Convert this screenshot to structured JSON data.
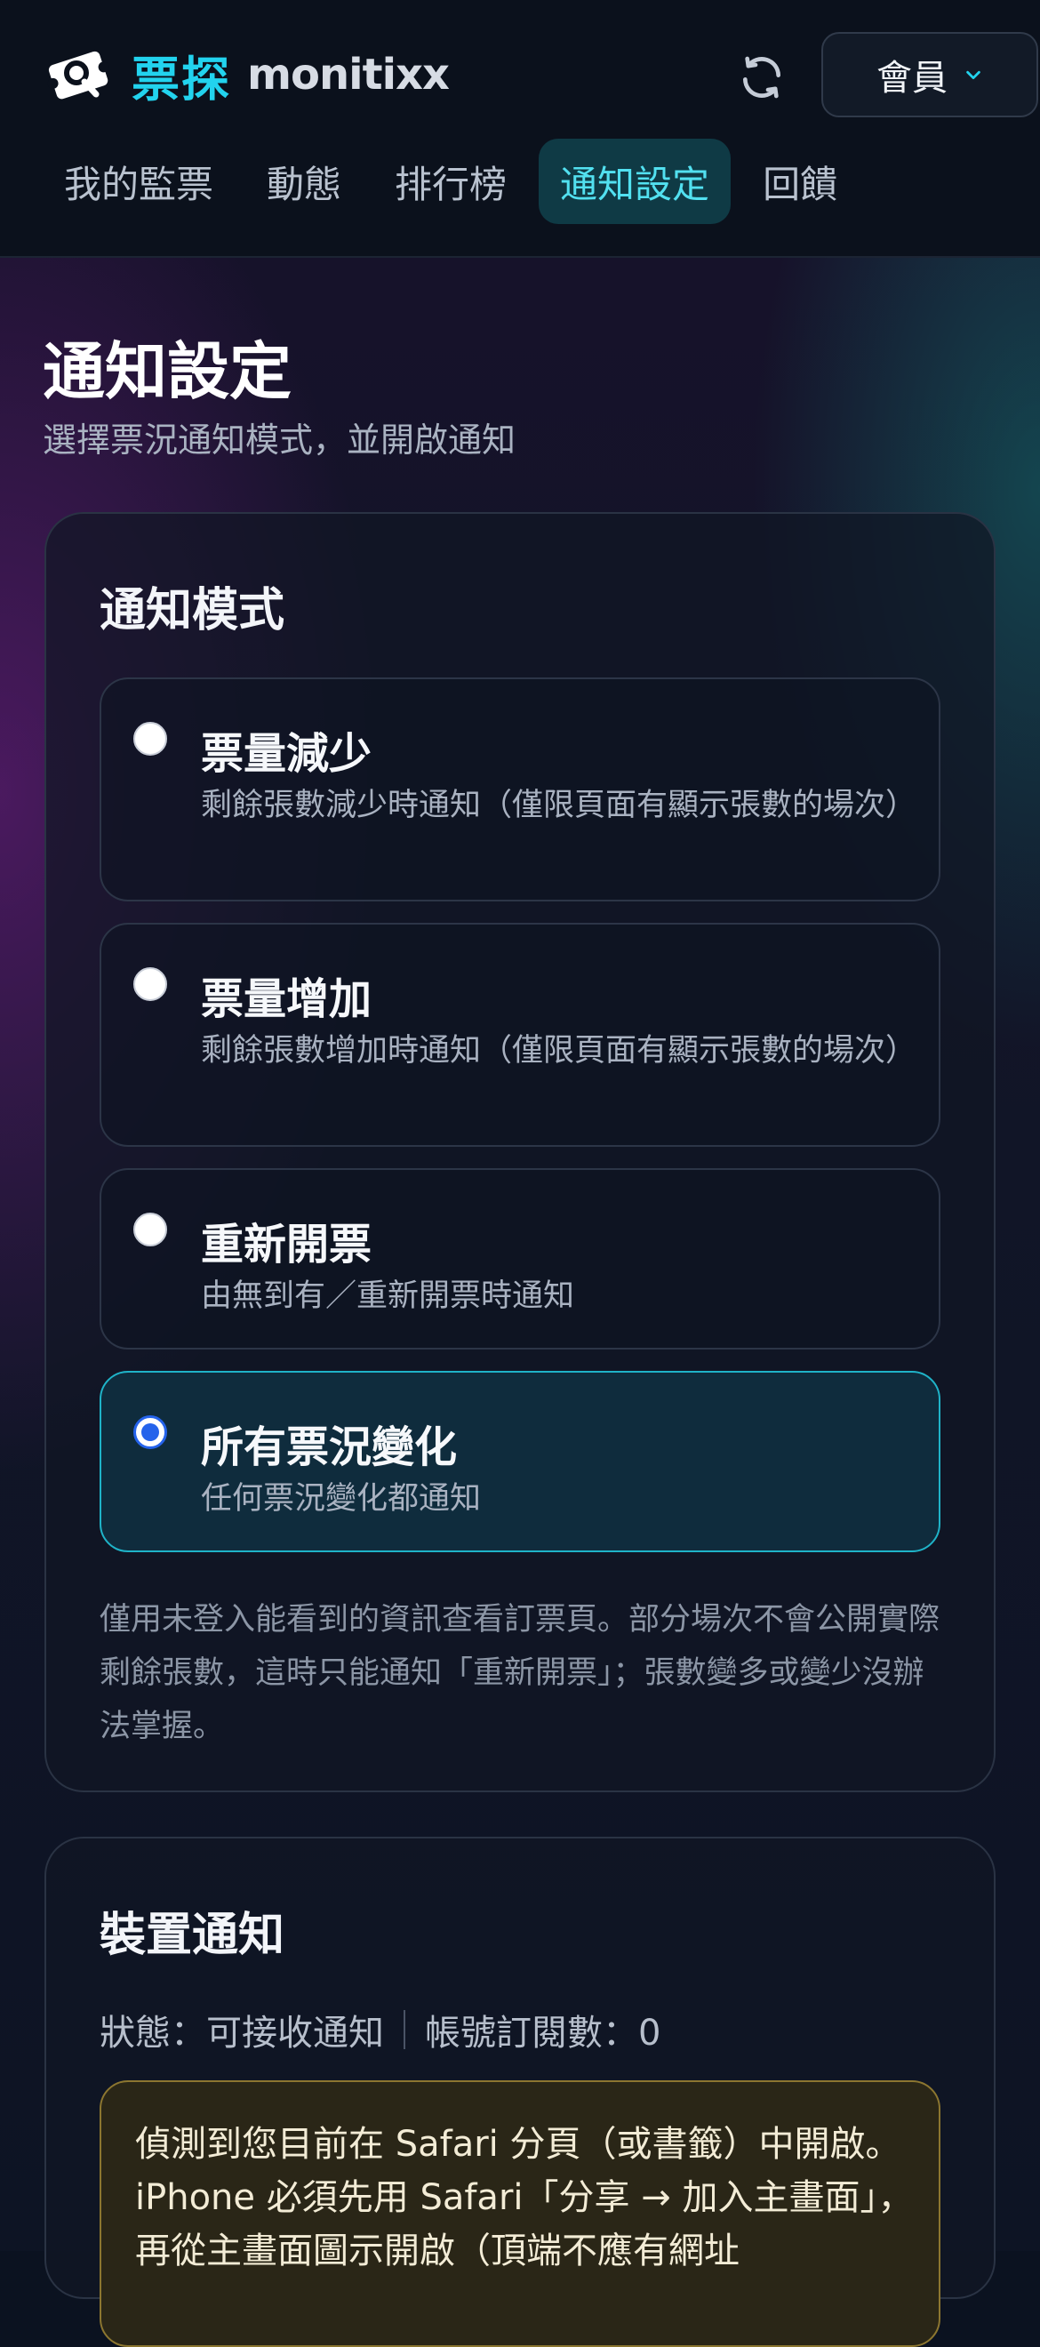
{
  "header": {
    "brand_cn": "票探",
    "brand_en": "monitixx",
    "member_label": "會員",
    "icons": {
      "logo": "ticket-magnifier-icon",
      "refresh": "refresh-icon",
      "chevron": "chevron-down-icon"
    }
  },
  "nav": {
    "tabs": [
      {
        "label": "我的監票",
        "active": false
      },
      {
        "label": "動態",
        "active": false
      },
      {
        "label": "排行榜",
        "active": false
      },
      {
        "label": "通知設定",
        "active": true
      },
      {
        "label": "回饋",
        "active": false
      }
    ]
  },
  "page": {
    "title": "通知設定",
    "subtitle": "選擇票況通知模式，並開啟通知"
  },
  "mode_card": {
    "title": "通知模式",
    "options": [
      {
        "title": "票量減少",
        "desc": "剩餘張數減少時通知（僅限頁面有顯示張數的場次）",
        "selected": false
      },
      {
        "title": "票量增加",
        "desc": "剩餘張數增加時通知（僅限頁面有顯示張數的場次）",
        "selected": false
      },
      {
        "title": "重新開票",
        "desc": "由無到有／重新開票時通知",
        "selected": false
      },
      {
        "title": "所有票況變化",
        "desc": "任何票況變化都通知",
        "selected": true
      }
    ],
    "note": "僅用未登入能看到的資訊查看訂票頁。部分場次不會公開實際剩餘張數，這時只能通知「重新開票」；張數變多或變少沒辦法掌握。"
  },
  "device_card": {
    "title": "裝置通知",
    "status": "狀態：可接收通知",
    "subscriptions": "帳號訂閱數：0",
    "warning": "偵測到您目前在 Safari 分頁（或書籤）中開啟。iPhone 必須先用 Safari「分享 → 加入主畫面」，再從主畫面圖示開啟（頂端不應有網址"
  },
  "colors": {
    "accent": "#22d3ee",
    "selected_border": "#1fb3c8",
    "radio_selected": "#2563eb",
    "warning_border": "#8c7630"
  }
}
